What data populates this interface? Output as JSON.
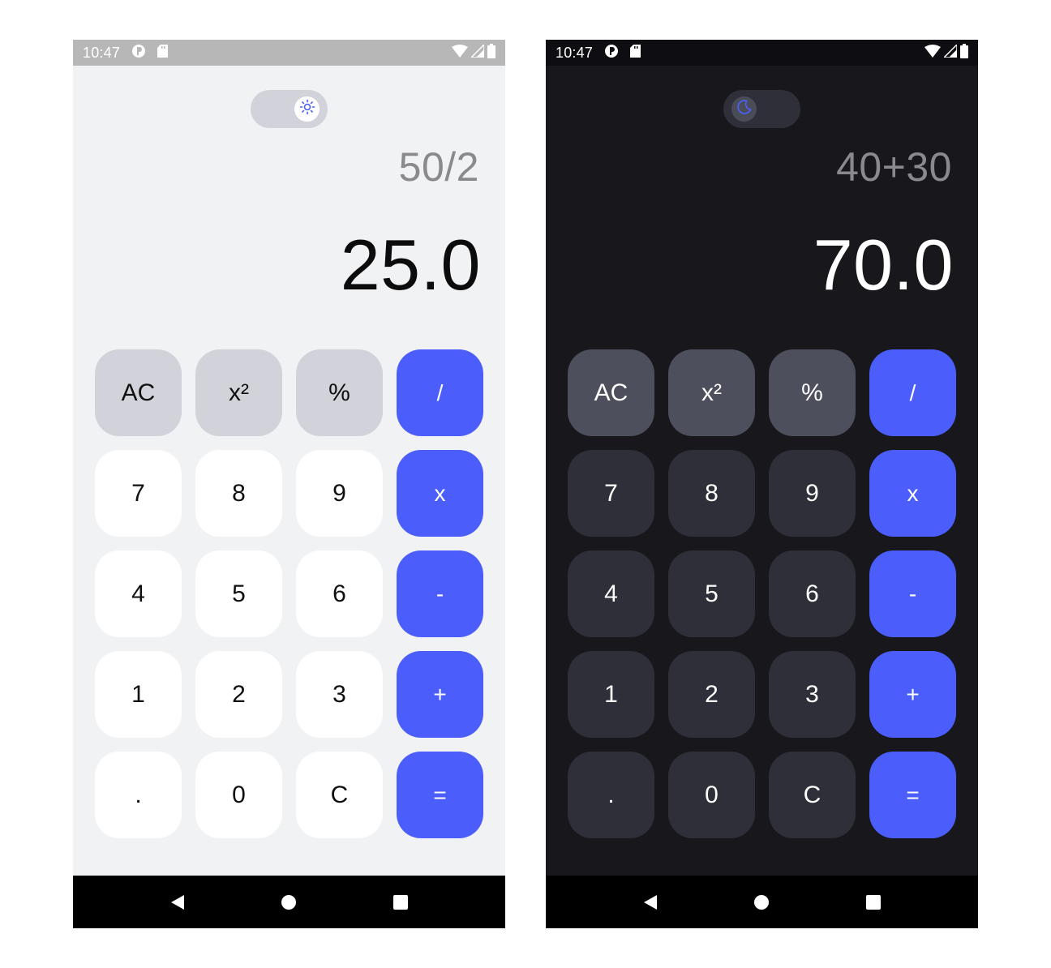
{
  "colors": {
    "accent": "#4b5efc",
    "light_bg": "#f1f2f4",
    "dark_bg": "#17171c",
    "light_key": "#ffffff",
    "light_fn_key": "#d2d3da",
    "dark_key": "#2e2f38",
    "dark_fn_key": "#4d4f5c"
  },
  "light": {
    "status": {
      "time": "10:47",
      "icons": [
        "notification-icon",
        "sd-card-icon",
        "wifi-icon",
        "signal-icon",
        "battery-icon"
      ]
    },
    "theme_toggle": {
      "mode": "light",
      "icon": "sun-icon"
    },
    "expression": "50/2",
    "result": "25.0",
    "keys": [
      {
        "label": "AC",
        "kind": "fn"
      },
      {
        "label": "x²",
        "kind": "fn"
      },
      {
        "label": "%",
        "kind": "fn"
      },
      {
        "label": "/",
        "kind": "op"
      },
      {
        "label": "7",
        "kind": "num"
      },
      {
        "label": "8",
        "kind": "num"
      },
      {
        "label": "9",
        "kind": "num"
      },
      {
        "label": "x",
        "kind": "op"
      },
      {
        "label": "4",
        "kind": "num"
      },
      {
        "label": "5",
        "kind": "num"
      },
      {
        "label": "6",
        "kind": "num"
      },
      {
        "label": "-",
        "kind": "op"
      },
      {
        "label": "1",
        "kind": "num"
      },
      {
        "label": "2",
        "kind": "num"
      },
      {
        "label": "3",
        "kind": "num"
      },
      {
        "label": "+",
        "kind": "op"
      },
      {
        "label": ".",
        "kind": "num"
      },
      {
        "label": "0",
        "kind": "num"
      },
      {
        "label": "C",
        "kind": "num"
      },
      {
        "label": "=",
        "kind": "op"
      }
    ],
    "nav": [
      "back-icon",
      "home-icon",
      "recents-icon"
    ]
  },
  "dark": {
    "status": {
      "time": "10:47",
      "icons": [
        "notification-icon",
        "sd-card-icon",
        "wifi-icon",
        "signal-icon",
        "battery-icon"
      ]
    },
    "theme_toggle": {
      "mode": "dark",
      "icon": "moon-icon"
    },
    "expression": "40+30",
    "result": "70.0",
    "keys": [
      {
        "label": "AC",
        "kind": "fn"
      },
      {
        "label": "x²",
        "kind": "fn"
      },
      {
        "label": "%",
        "kind": "fn"
      },
      {
        "label": "/",
        "kind": "op"
      },
      {
        "label": "7",
        "kind": "num"
      },
      {
        "label": "8",
        "kind": "num"
      },
      {
        "label": "9",
        "kind": "num"
      },
      {
        "label": "x",
        "kind": "op"
      },
      {
        "label": "4",
        "kind": "num"
      },
      {
        "label": "5",
        "kind": "num"
      },
      {
        "label": "6",
        "kind": "num"
      },
      {
        "label": "-",
        "kind": "op"
      },
      {
        "label": "1",
        "kind": "num"
      },
      {
        "label": "2",
        "kind": "num"
      },
      {
        "label": "3",
        "kind": "num"
      },
      {
        "label": "+",
        "kind": "op"
      },
      {
        "label": ".",
        "kind": "num"
      },
      {
        "label": "0",
        "kind": "num"
      },
      {
        "label": "C",
        "kind": "num"
      },
      {
        "label": "=",
        "kind": "op"
      }
    ],
    "nav": [
      "back-icon",
      "home-icon",
      "recents-icon"
    ]
  }
}
